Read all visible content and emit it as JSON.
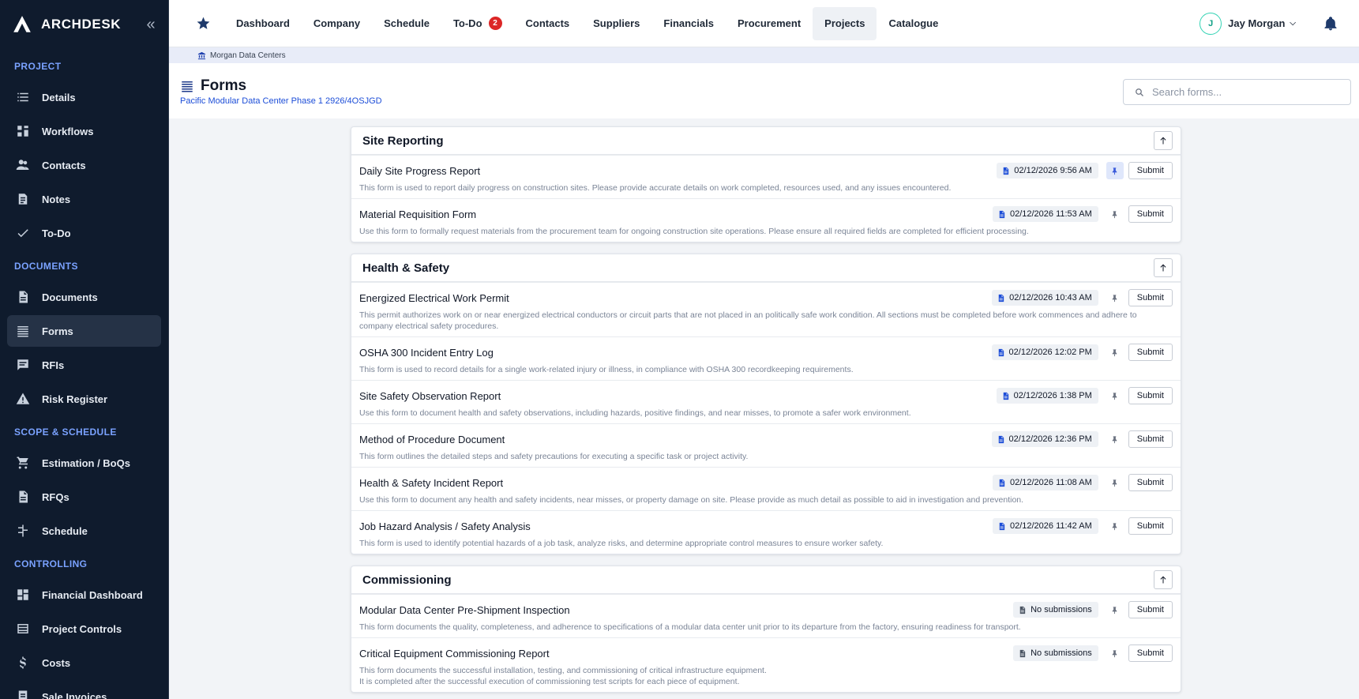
{
  "brand": {
    "name": "ARCHDESK",
    "collapse_icon": "«"
  },
  "sidebar": {
    "sections": [
      {
        "title": "PROJECT",
        "items": [
          {
            "label": "Details",
            "icon": "list-icon"
          },
          {
            "label": "Workflows",
            "icon": "workflow-icon"
          },
          {
            "label": "Contacts",
            "icon": "people-icon"
          },
          {
            "label": "Notes",
            "icon": "note-icon"
          },
          {
            "label": "To-Do",
            "icon": "check-icon"
          }
        ]
      },
      {
        "title": "DOCUMENTS",
        "items": [
          {
            "label": "Documents",
            "icon": "document-icon"
          },
          {
            "label": "Forms",
            "icon": "forms-icon"
          },
          {
            "label": "RFIs",
            "icon": "chat-icon"
          },
          {
            "label": "Risk Register",
            "icon": "warning-icon"
          }
        ]
      },
      {
        "title": "SCOPE & SCHEDULE",
        "items": [
          {
            "label": "Estimation / BoQs",
            "icon": "cart-icon"
          },
          {
            "label": "RFQs",
            "icon": "document-icon"
          },
          {
            "label": "Schedule",
            "icon": "schedule-icon"
          }
        ]
      },
      {
        "title": "CONTROLLING",
        "items": [
          {
            "label": "Financial Dashboard",
            "icon": "dashboard-icon"
          },
          {
            "label": "Project Controls",
            "icon": "table-icon"
          },
          {
            "label": "Costs",
            "icon": "dollar-icon"
          },
          {
            "label": "Sale Invoices",
            "icon": "invoice-icon"
          }
        ]
      }
    ],
    "active": "Forms"
  },
  "topnav": {
    "tabs": [
      {
        "label": "Dashboard"
      },
      {
        "label": "Company"
      },
      {
        "label": "Schedule"
      },
      {
        "label": "To-Do",
        "badge": "2"
      },
      {
        "label": "Contacts"
      },
      {
        "label": "Suppliers"
      },
      {
        "label": "Financials"
      },
      {
        "label": "Procurement"
      },
      {
        "label": "Projects"
      },
      {
        "label": "Catalogue"
      }
    ],
    "active": "Projects",
    "user": {
      "initial": "J",
      "name": "Jay Morgan"
    }
  },
  "breadcrumb": {
    "company": "Morgan Data Centers"
  },
  "header": {
    "title": "Forms",
    "subtitle": "Pacific Modular Data Center Phase 1 2926/4OSJGD",
    "search_placeholder": "Search forms..."
  },
  "groups": [
    {
      "title": "Site Reporting",
      "forms": [
        {
          "name": "Daily Site Progress Report",
          "status": "02/12/2026 9:56 AM",
          "pinned": true,
          "submit": "Submit",
          "description": "This form is used to report daily progress on construction sites. Please provide accurate details on work completed, resources used, and any issues encountered."
        },
        {
          "name": "Material Requisition Form",
          "status": "02/12/2026 11:53 AM",
          "pinned": false,
          "submit": "Submit",
          "description": "Use this form to formally request materials from the procurement team for ongoing construction site operations. Please ensure all required fields are completed for efficient processing."
        }
      ]
    },
    {
      "title": "Health & Safety",
      "forms": [
        {
          "name": "Energized Electrical Work Permit",
          "status": "02/12/2026 10:43 AM",
          "pinned": false,
          "submit": "Submit",
          "description": "This permit authorizes work on or near energized electrical conductors or circuit parts that are not placed in an politically safe work condition. All sections must be completed before work commences and adhere to company electrical safety procedures."
        },
        {
          "name": "OSHA 300 Incident Entry Log",
          "status": "02/12/2026 12:02 PM",
          "pinned": false,
          "submit": "Submit",
          "description": "This form is used to record details for a single work-related injury or illness, in compliance with OSHA 300 recordkeeping requirements."
        },
        {
          "name": "Site Safety Observation Report",
          "status": "02/12/2026 1:38 PM",
          "pinned": false,
          "submit": "Submit",
          "description": "Use this form to document health and safety observations, including hazards, positive findings, and near misses, to promote a safer work environment."
        },
        {
          "name": "Method of Procedure Document",
          "status": "02/12/2026 12:36 PM",
          "pinned": false,
          "submit": "Submit",
          "description": "This form outlines the detailed steps and safety precautions for executing a specific task or project activity."
        },
        {
          "name": "Health & Safety Incident Report",
          "status": "02/12/2026 11:08 AM",
          "pinned": false,
          "submit": "Submit",
          "description": "Use this form to document any health and safety incidents, near misses, or property damage on site. Please provide as much detail as possible to aid in investigation and prevention."
        },
        {
          "name": "Job Hazard Analysis / Safety Analysis",
          "status": "02/12/2026 11:42 AM",
          "pinned": false,
          "submit": "Submit",
          "description": "This form is used to identify potential hazards of a job task, analyze risks, and determine appropriate control measures to ensure worker safety."
        }
      ]
    },
    {
      "title": "Commissioning",
      "forms": [
        {
          "name": "Modular Data Center Pre-Shipment Inspection",
          "status": "No submissions",
          "pinned": false,
          "submit": "Submit",
          "description": "This form documents the quality, completeness, and adherence to specifications of a modular data center unit prior to its departure from the factory, ensuring readiness for transport."
        },
        {
          "name": "Critical Equipment Commissioning Report",
          "status": "No submissions",
          "pinned": false,
          "submit": "Submit",
          "description": "This form documents the successful installation, testing, and commissioning of critical infrastructure equipment.\nIt is completed after the successful execution of commissioning test scripts for each piece of equipment."
        }
      ]
    }
  ],
  "colors": {
    "sidebar_bg": "#0f1b2d",
    "accent": "#1d4ed8",
    "section_label": "#7aa2ff",
    "badge": "#dc2626"
  }
}
